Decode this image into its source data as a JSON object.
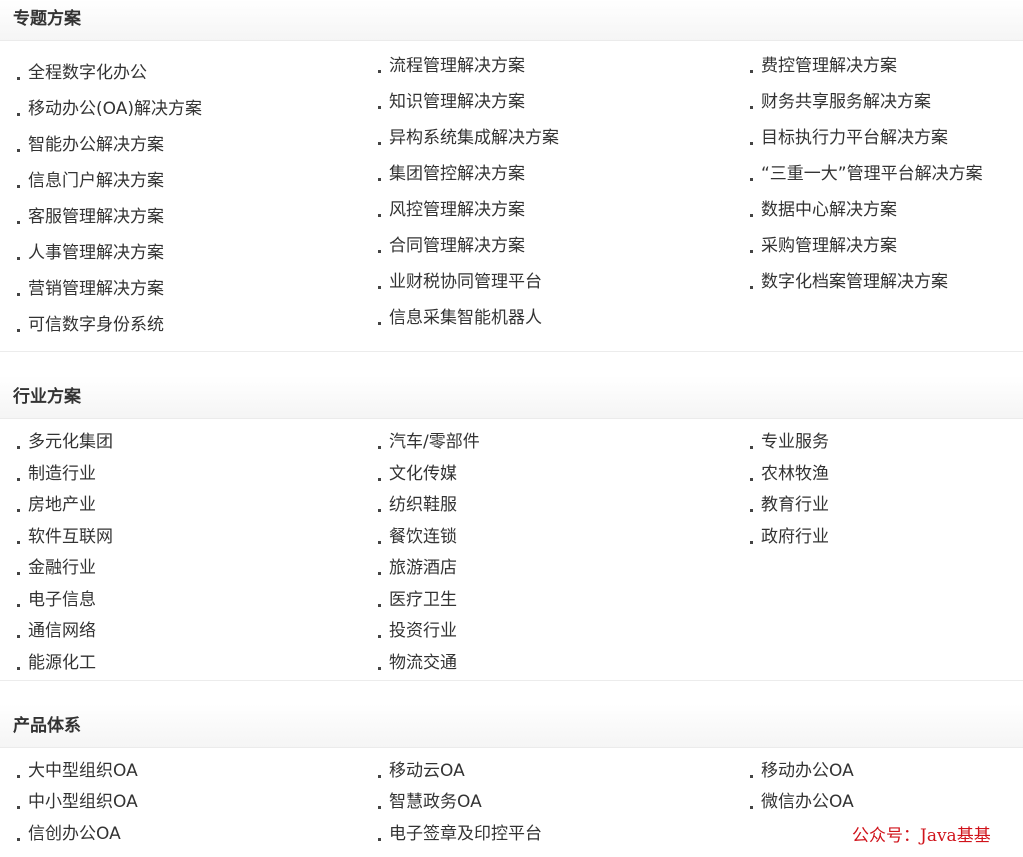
{
  "sections": [
    {
      "title": "专题方案",
      "columns": [
        [
          "全程数字化办公",
          "移动办公(OA)解决方案",
          "智能办公解决方案",
          "信息门户解决方案",
          "客服管理解决方案",
          "人事管理解决方案",
          "营销管理解决方案",
          "可信数字身份系统"
        ],
        [
          "流程管理解决方案",
          "知识管理解决方案",
          "异构系统集成解决方案",
          "集团管控解决方案",
          "风控管理解决方案",
          "合同管理解决方案",
          "业财税协同管理平台",
          "信息采集智能机器人"
        ],
        [
          "费控管理解决方案",
          "财务共享服务解决方案",
          "目标执行力平台解决方案",
          "“三重一大”管理平台解决方案",
          "数据中心解决方案",
          "采购管理解决方案",
          "数字化档案管理解决方案"
        ]
      ]
    },
    {
      "title": "行业方案",
      "columns": [
        [
          "多元化集团",
          "制造行业",
          "房地产业",
          "软件互联网",
          "金融行业",
          "电子信息",
          "通信网络",
          "能源化工"
        ],
        [
          "汽车/零部件",
          "文化传媒",
          "纺织鞋服",
          "餐饮连锁",
          "旅游酒店",
          "医疗卫生",
          "投资行业",
          "物流交通"
        ],
        [
          "专业服务",
          "农林牧渔",
          "教育行业",
          "政府行业"
        ]
      ]
    },
    {
      "title": "产品体系",
      "columns": [
        [
          "大中型组织OA",
          "中小型组织OA",
          "信创办公OA"
        ],
        [
          "移动云OA",
          "智慧政务OA",
          "电子签章及印控平台"
        ],
        [
          "移动办公OA",
          "微信办公OA"
        ]
      ]
    }
  ],
  "watermark": "公众号：Java基基"
}
